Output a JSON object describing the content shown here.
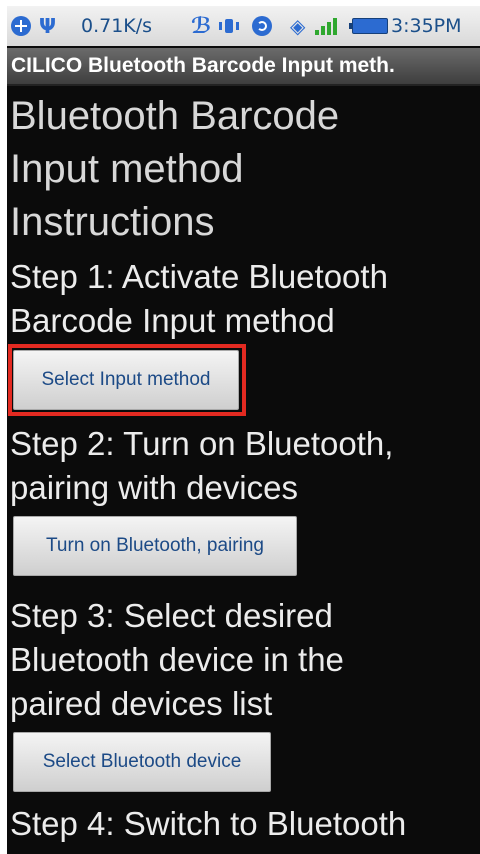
{
  "status_bar": {
    "net_speed": "0.71K/s",
    "time": "3:35PM",
    "icons": [
      "add-circle-icon",
      "usb-icon",
      "bluetooth-icon",
      "vibrate-icon",
      "sync-icon",
      "wifi-icon",
      "signal-icon",
      "battery-icon"
    ]
  },
  "app_title": "CILICO Bluetooth Barcode Input meth.",
  "instructions": {
    "heading_lines": [
      "Bluetooth Barcode",
      "Input method",
      "Instructions"
    ],
    "steps": [
      {
        "lines": [
          "Step 1: Activate Bluetooth",
          "Barcode Input method"
        ],
        "button": "Select Input method",
        "highlighted": true
      },
      {
        "lines": [
          "Step 2: Turn on Bluetooth,",
          "pairing with devices"
        ],
        "button": "Turn on Bluetooth, pairing",
        "highlighted": false
      },
      {
        "lines": [
          "Step 3: Select desired",
          "Bluetooth device in the",
          "paired devices list"
        ],
        "button": "Select Bluetooth device",
        "highlighted": false
      },
      {
        "lines": [
          "Step 4: Switch to Bluetooth"
        ],
        "button": null,
        "highlighted": false
      }
    ]
  },
  "colors": {
    "background": "#0b0b0b",
    "text": "#ececec",
    "button_text": "#1c4a86",
    "highlight": "#e32a21",
    "status_icon": "#2c6bd1"
  }
}
